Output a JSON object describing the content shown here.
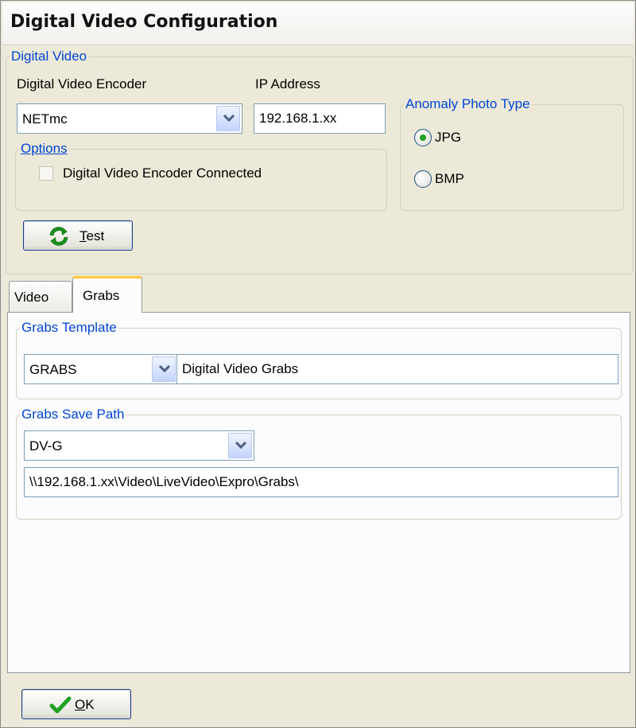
{
  "window": {
    "title": "Digital Video Configuration"
  },
  "digital_video": {
    "group_label": "Digital Video",
    "encoder_label": "Digital Video Encoder",
    "encoder_value": "NETmc",
    "ip_label": "IP Address",
    "ip_value": "192.168.1.xx",
    "options": {
      "group_label": "Options",
      "connected_label": "Digital Video Encoder Connected",
      "connected_checked": false
    },
    "anomaly": {
      "group_label": "Anomaly Photo Type",
      "options": [
        "JPG",
        "BMP"
      ],
      "selected": "JPG"
    },
    "test_button": {
      "mnemonic": "T",
      "rest": "est",
      "icon": "refresh-icon"
    }
  },
  "tabs": [
    {
      "label": "Video",
      "active": false
    },
    {
      "label": "Grabs",
      "active": true
    }
  ],
  "grabs": {
    "template": {
      "group_label": "Grabs Template",
      "code": "GRABS",
      "description": "Digital Video Grabs"
    },
    "save_path": {
      "group_label": "Grabs Save Path",
      "location": "DV-G",
      "path": "\\\\192.168.1.xx\\Video\\LiveVideo\\Expro\\Grabs\\"
    }
  },
  "footer": {
    "ok_button": {
      "mnemonic": "O",
      "rest": "K",
      "icon": "checkmark-icon"
    }
  },
  "colors": {
    "accent": "#0046d5",
    "window_bg": "#ece9d8",
    "tab_highlight": "#ffc83c",
    "check_green": "#21a121"
  }
}
